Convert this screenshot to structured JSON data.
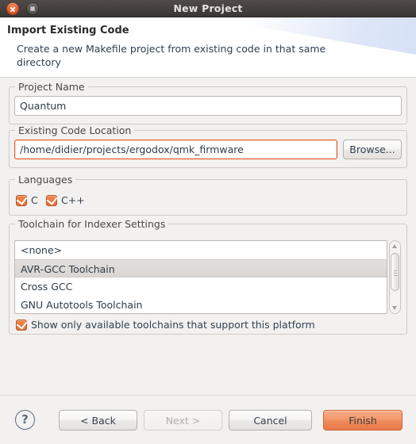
{
  "window": {
    "title": "New Project",
    "close_icon": "close-icon",
    "maximize_icon": "maximize-icon"
  },
  "header": {
    "title": "Import Existing Code",
    "description": "Create a new Makefile project from existing code in that same directory"
  },
  "project_name": {
    "legend": "Project Name",
    "value": "Quantum",
    "placeholder": ""
  },
  "existing_code_location": {
    "legend": "Existing Code Location",
    "value": "/home/didier/projects/ergodox/qmk_firmware",
    "placeholder": "",
    "browse_label": "Browse..."
  },
  "languages": {
    "legend": "Languages",
    "items": [
      {
        "label": "C",
        "checked": true
      },
      {
        "label": "C++",
        "checked": true
      }
    ]
  },
  "toolchain": {
    "legend": "Toolchain for Indexer Settings",
    "items": [
      {
        "label": "<none>",
        "selected": false
      },
      {
        "label": "AVR-GCC Toolchain",
        "selected": true
      },
      {
        "label": "Cross GCC",
        "selected": false
      },
      {
        "label": "GNU Autotools Toolchain",
        "selected": false
      }
    ],
    "show_only_available": {
      "label": "Show only available toolchains that support this platform",
      "checked": true
    }
  },
  "footer": {
    "help_label": "?",
    "back_label": "< Back",
    "next_label": "Next >",
    "cancel_label": "Cancel",
    "finish_label": "Finish"
  },
  "colors": {
    "accent": "#e2572a",
    "titlebar": "#464140",
    "panel": "#f2f1f0",
    "field_border_focus": "#e2572a",
    "text": "#33414f"
  }
}
